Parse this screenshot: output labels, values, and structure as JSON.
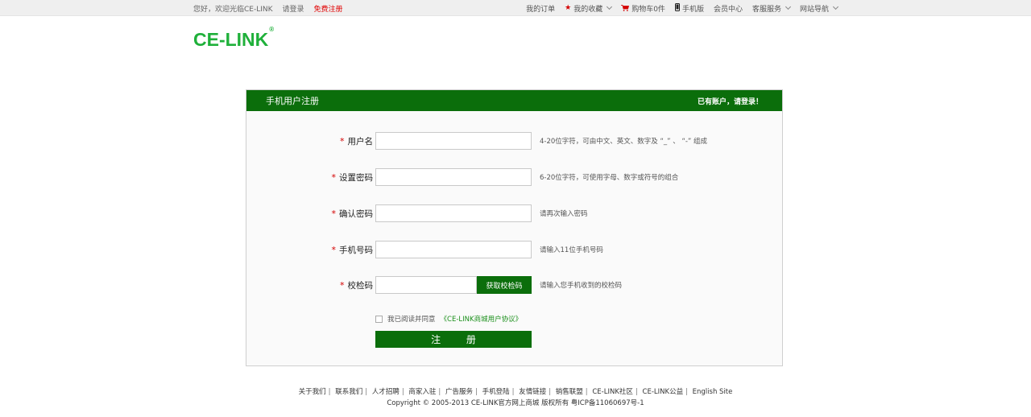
{
  "topbar": {
    "greeting": "您好，欢迎光临CE-LINK",
    "login": "请登录",
    "register": "免费注册",
    "my_orders": "我的订单",
    "favorites": "我的收藏",
    "cart": "购物车0件",
    "mobile": "手机版",
    "member_center": "会员中心",
    "customer_service": "客服服务",
    "site_nav": "网站导航"
  },
  "logo": {
    "text": "CE-LINK",
    "mark": "®",
    "color": "#1fb03a"
  },
  "panel": {
    "title": "手机用户注册",
    "login_link": "已有账户，请登录！",
    "header_color": "#0b6e0b"
  },
  "form": {
    "fields": [
      {
        "label": "用户名",
        "required_mark": "*",
        "value": "",
        "hint": "4-20位字符，可由中文、英文、数字及 “_” 、 “-” 组成"
      },
      {
        "label": "设置密码",
        "required_mark": "*",
        "value": "",
        "hint": "6-20位字符，可使用字母、数字或符号的组合"
      },
      {
        "label": "确认密码",
        "required_mark": "*",
        "value": "",
        "hint": "请再次输入密码"
      },
      {
        "label": "手机号码",
        "required_mark": "*",
        "value": "",
        "hint": "请输入11位手机号码"
      },
      {
        "label": "校检码",
        "required_mark": "*",
        "value": "",
        "hint": "请输入您手机收到的校检码",
        "button": "获取校检码"
      }
    ],
    "agreement_text": "我已阅读并同意",
    "agreement_link": "《CE-LINK商城用户协议》",
    "agreement_checked": false,
    "submit": "注 册"
  },
  "footer": {
    "links": [
      "关于我们",
      "联系我们",
      "人才招聘",
      "商家入驻",
      "广告服务",
      "手机登陆",
      "友情链接",
      "销售联盟",
      "CE-LINK社区",
      "CE-LINK公益",
      "English Site"
    ],
    "copyright": "Copyright © 2005-2013 CE-LINK官方网上商城 版权所有 粤ICP备11060697号-1"
  }
}
